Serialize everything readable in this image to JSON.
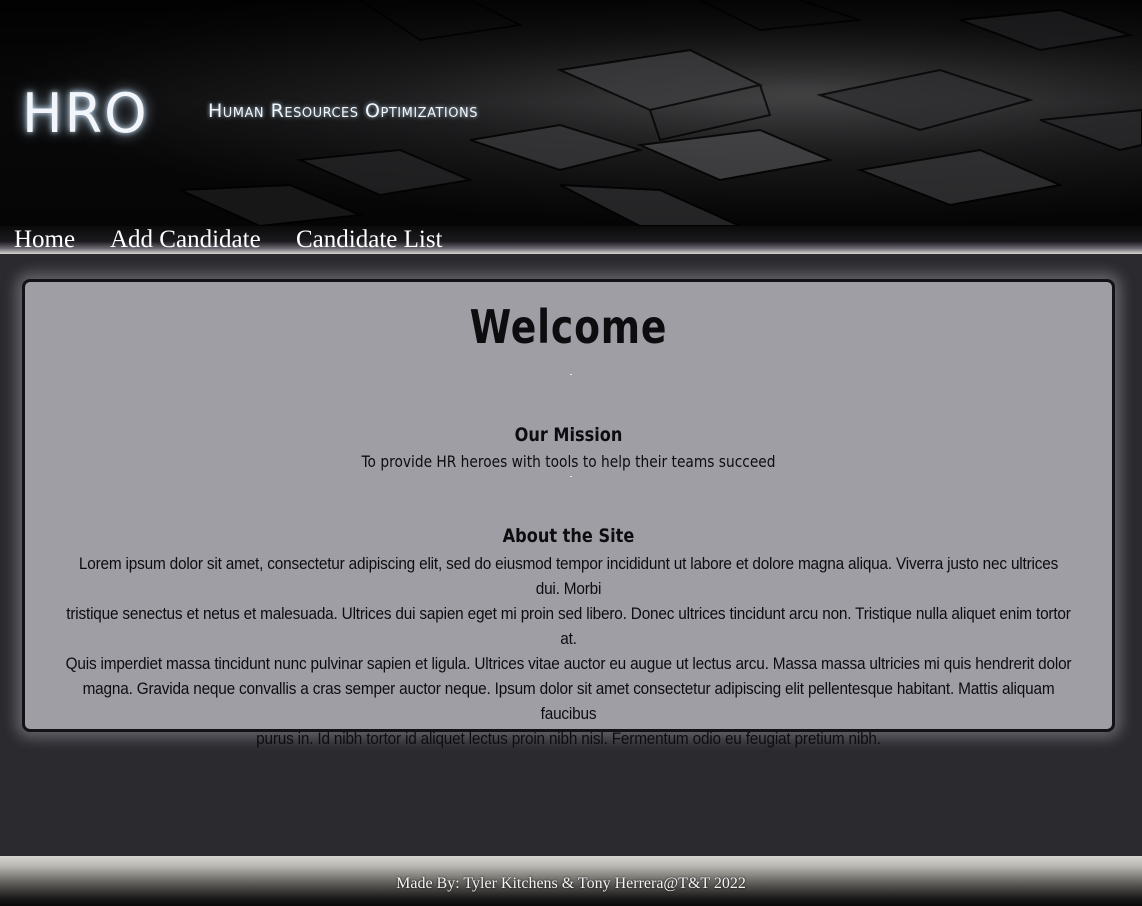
{
  "header": {
    "logo": "HRO",
    "tagline": "Human Resources Optimizations"
  },
  "nav": {
    "items": [
      "Home",
      "Add Candidate",
      "Candidate List"
    ]
  },
  "main": {
    "title": "Welcome",
    "mission_heading": "Our Mission",
    "mission_text": "To provide HR heroes with tools to help their teams succeed",
    "about_heading": "About the Site",
    "about_lines": [
      "Lorem ipsum dolor sit amet, consectetur adipiscing elit, sed do eiusmod tempor incididunt ut labore et dolore magna aliqua. Viverra justo nec ultrices dui. Morbi",
      "tristique senectus et netus et malesuada. Ultrices dui sapien eget mi proin sed libero. Donec ultrices tincidunt arcu non. Tristique nulla aliquet enim tortor at.",
      "Quis imperdiet massa tincidunt nunc pulvinar sapien et ligula. Ultrices vitae auctor eu augue ut lectus arcu. Massa massa ultricies mi quis hendrerit dolor",
      "magna. Gravida neque convallis a cras semper auctor neque. Ipsum dolor sit amet consectetur adipiscing elit pellentesque habitant. Mattis aliquam faucibus",
      "purus in. Id nibh tortor id aliquet lectus proin nibh nisl. Fermentum odio eu feugiat pretium nibh."
    ]
  },
  "footer": {
    "text": "Made By: Tyler Kitchens & Tony Herrera@T&T 2022"
  }
}
